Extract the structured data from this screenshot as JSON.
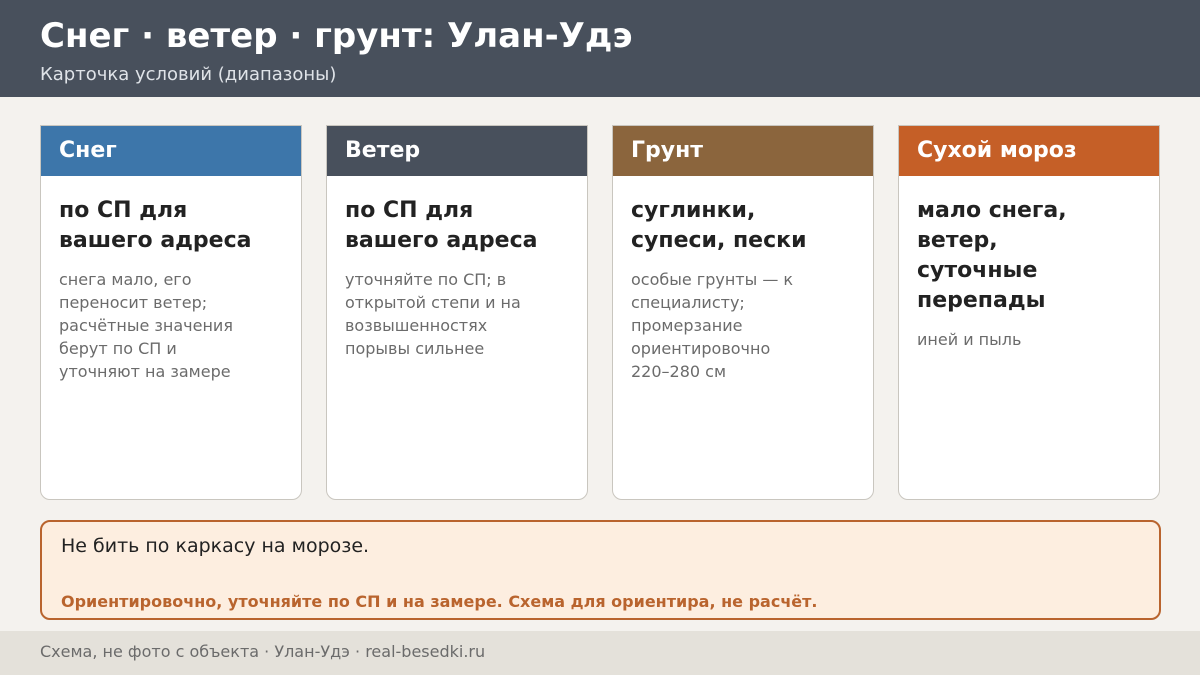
{
  "header": {
    "title": "Снег · ветер · грунт: Улан-Удэ",
    "subtitle": "Карточка условий (диапазоны)"
  },
  "colors": {
    "header_bg": "#48505c",
    "snow": "#3d76aa",
    "wind": "#48505c",
    "soil": "#8b653d",
    "frost": "#c55f27",
    "accent": "#b9642e"
  },
  "cards": [
    {
      "label": "Снег",
      "headline": "по СП для вашего адреса",
      "text": "снега мало, его переносит ветер; расчётные значения берут по СП и уточняют на замере"
    },
    {
      "label": "Ветер",
      "headline": "по СП для вашего адреса",
      "text": "уточняйте по СП; в открытой степи и на возвышенностях порывы сильнее"
    },
    {
      "label": "Грунт",
      "headline": "суглинки, супеси, пески",
      "text": "особые грунты — к специалисту; промерзание ориентировочно 220–280 см"
    },
    {
      "label": "Сухой мороз",
      "headline": "мало снега, ветер, суточные перепады",
      "text": "иней и пыль"
    }
  ],
  "note": {
    "main": "Не бить по каркасу на морозе.",
    "disclaimer": "Ориентировочно, уточняйте по СП и на замере. Схема для ориентира, не расчёт."
  },
  "footer": {
    "text": "Схема, не фото с объекта  ·  Улан-Удэ  ·  real-besedki.ru"
  }
}
